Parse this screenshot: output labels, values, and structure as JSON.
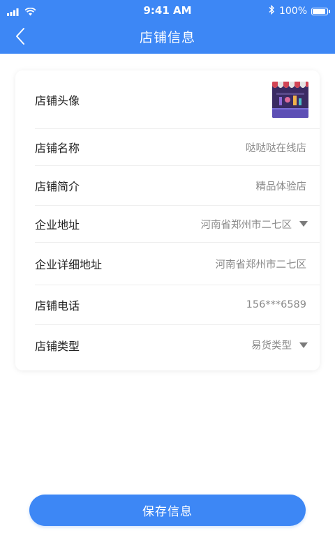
{
  "status_bar": {
    "time": "9:41 AM",
    "battery": "100%",
    "battery_level": 1.0
  },
  "header": {
    "title": "店铺信息",
    "back_icon": "chevron-left-icon"
  },
  "rows": [
    {
      "label": "店铺头像",
      "value": "",
      "type": "avatar"
    },
    {
      "label": "店铺名称",
      "value": "哒哒哒在线店",
      "type": "text"
    },
    {
      "label": "店铺简介",
      "value": "精品体验店",
      "type": "text"
    },
    {
      "label": "企业地址",
      "value": "河南省郑州市二七区",
      "type": "dropdown"
    },
    {
      "label": "企业详细地址",
      "value": "河南省郑州市二七区",
      "type": "text"
    },
    {
      "label": "店铺电话",
      "value": "156***6589",
      "type": "text"
    },
    {
      "label": "店铺类型",
      "value": "易货类型",
      "type": "dropdown"
    }
  ],
  "save_button": {
    "label": "保存信息"
  },
  "colors": {
    "primary": "#3d87f5",
    "label": "#222222",
    "value": "#8a8a8a",
    "divider": "#eeeeee"
  }
}
